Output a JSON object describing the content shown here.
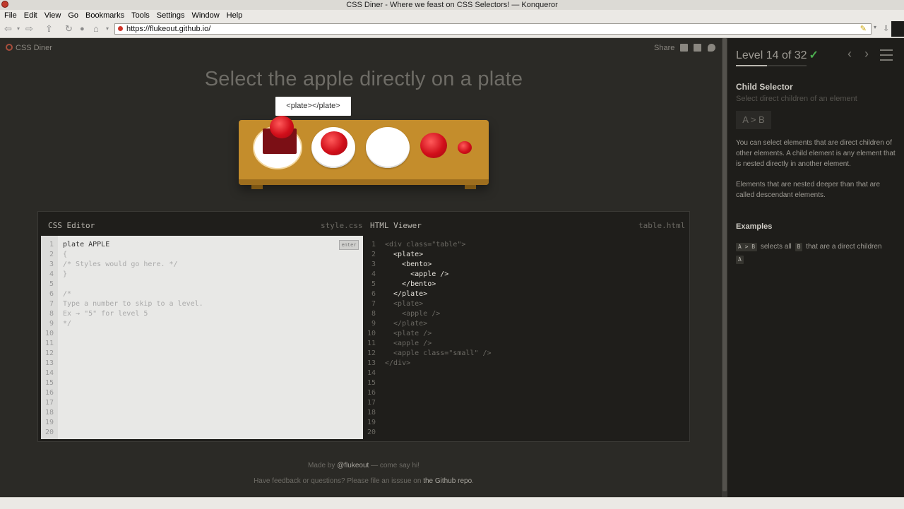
{
  "window": {
    "title": "CSS Diner - Where we feast on CSS Selectors! — Konqueror"
  },
  "menu": [
    "File",
    "Edit",
    "View",
    "Go",
    "Bookmarks",
    "Tools",
    "Settings",
    "Window",
    "Help"
  ],
  "toolbar": {
    "url": "https://flukeout.github.io/"
  },
  "game": {
    "logo": "CSS Diner",
    "share_label": "Share",
    "headline": "Select the apple directly on a plate",
    "tooltip": "<plate></plate>"
  },
  "editor": {
    "css_title": "CSS Editor",
    "css_file": "style.css",
    "html_title": "HTML Viewer",
    "html_file": "table.html",
    "enter_label": "enter",
    "css_lines": [
      "plate APPLE",
      "{",
      "/* Styles would go here. */",
      "}",
      "",
      "/*",
      "Type a number to skip to a level.",
      "Ex → \"5\" for level 5",
      "*/",
      "",
      "",
      "",
      "",
      "",
      "",
      "",
      "",
      "",
      "",
      ""
    ],
    "html_lines": [
      "<div class=\"table\">",
      "  <plate>",
      "    <bento>",
      "      <apple />",
      "    </bento>",
      "  </plate>",
      "  <plate>",
      "    <apple />",
      "  </plate>",
      "  <plate />",
      "  <apple />",
      "  <apple class=\"small\" />",
      "</div>",
      "",
      "",
      "",
      "",
      "",
      "",
      ""
    ],
    "line_numbers": [
      "1",
      "2",
      "3",
      "4",
      "5",
      "6",
      "7",
      "8",
      "9",
      "10",
      "11",
      "12",
      "13",
      "14",
      "15",
      "16",
      "17",
      "18",
      "19",
      "20"
    ]
  },
  "footer": {
    "made_by_prefix": "Made by ",
    "made_by_link": "@flukeout",
    "made_by_suffix": " — come say hi!",
    "feedback_prefix": "Have feedback or questions? Please file an isssue on ",
    "feedback_link": "the Github repo",
    "feedback_suffix": "."
  },
  "sidebar": {
    "level_label": "Level 14 of 32",
    "level_current": 14,
    "level_total": 32,
    "title": "Child Selector",
    "subtitle": "Select direct children of an element",
    "syntax": "A > B",
    "para1": "You can select elements that are direct children of other elements. A child element is any element that is nested directly in another element.",
    "para2": "Elements that are nested deeper than that are called descendant elements.",
    "examples_heading": "Examples",
    "example_code": "A > B",
    "example_text_1": "selects all",
    "example_b": "B",
    "example_text_2": "that are a direct children",
    "example_a": "A"
  },
  "colors": {
    "accent_check": "#4caf50",
    "table_wood": "#c48d2c",
    "apple_red": "#d10f1a"
  }
}
